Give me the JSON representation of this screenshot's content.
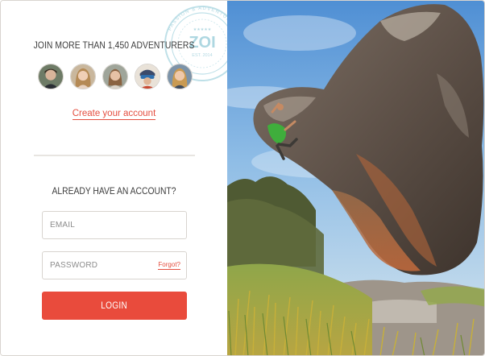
{
  "signup": {
    "heading": "JOIN MORE THAN 1,450 ADVENTURERS",
    "create_account_link": "Create your account",
    "avatars": [
      {
        "name": "adventurer-1"
      },
      {
        "name": "adventurer-2"
      },
      {
        "name": "adventurer-3"
      },
      {
        "name": "adventurer-4"
      },
      {
        "name": "adventurer-5"
      }
    ]
  },
  "stamp": {
    "logo_text": "ZOI",
    "ring_text": "PASSION & ADVENTURE",
    "est_text": "EST. 2014"
  },
  "login": {
    "heading": "ALREADY HAVE AN ACCOUNT?",
    "email_placeholder": "EMAIL",
    "password_placeholder": "PASSWORD",
    "forgot_link": "Forgot?",
    "button_label": "LOGIN"
  },
  "colors": {
    "accent": "#e94b3c",
    "link": "#e44e3f",
    "heading": "#3c3c3c",
    "stamp": "#a9d6e2"
  }
}
